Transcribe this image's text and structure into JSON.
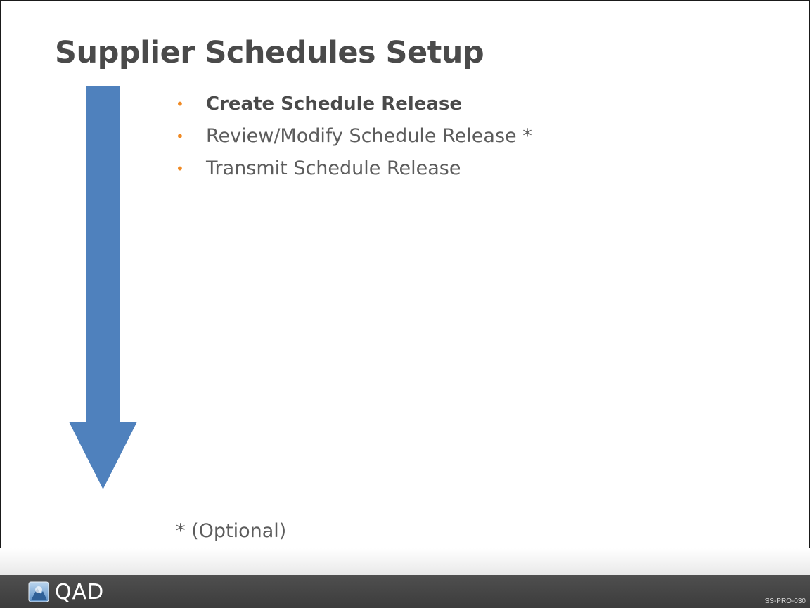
{
  "slide": {
    "title": "Supplier Schedules Setup",
    "arrow_color": "#4f81bd",
    "bullet_color": "#f08a24",
    "bullets": [
      {
        "text": "Create Schedule Release",
        "bold": true
      },
      {
        "text": "Review/Modify Schedule Release *",
        "bold": false
      },
      {
        "text": "Transmit Schedule Release",
        "bold": false
      }
    ],
    "bullet_marker": "•",
    "footnote": "* (Optional)"
  },
  "footer": {
    "logo_text": "QAD",
    "slide_code": "SS-PRO-030"
  }
}
